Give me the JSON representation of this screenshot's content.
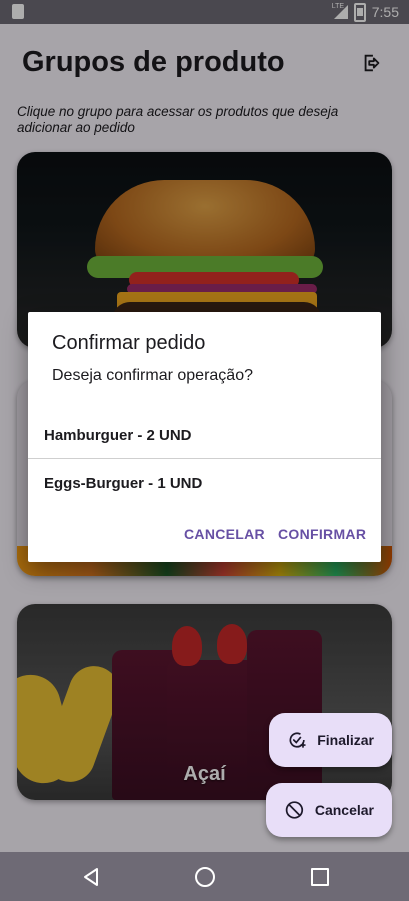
{
  "status_bar": {
    "time": "7:55",
    "network": "LTE"
  },
  "header": {
    "title": "Grupos de produto",
    "logout_icon": "logout-icon",
    "subtitle": "Clique no grupo para acessar os produtos que deseja adicionar ao pedido"
  },
  "groups": [
    {
      "label": "",
      "image": "hamburger"
    },
    {
      "label": "",
      "image": "drinks"
    },
    {
      "label": "Açaí",
      "image": "acai"
    }
  ],
  "fabs": {
    "finalizar": "Finalizar",
    "cancelar": "Cancelar"
  },
  "dialog": {
    "title": "Confirmar pedido",
    "message": "Deseja confirmar operação?",
    "items": [
      "Hamburguer - 2 UND",
      "Eggs-Burguer - 1 UND"
    ],
    "cancel_label": "CANCELAR",
    "confirm_label": "CONFIRMAR"
  },
  "colors": {
    "accent": "#6750a4",
    "fab_bg": "#e8def8",
    "scrim": "rgba(0,0,0,0.32)"
  }
}
